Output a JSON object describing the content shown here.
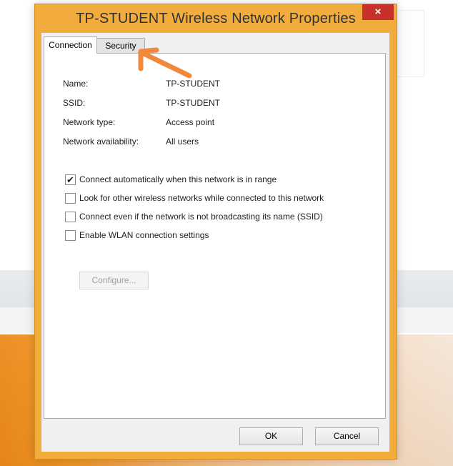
{
  "window": {
    "title": "TP-STUDENT Wireless Network Properties",
    "close_label": "×"
  },
  "tabs": [
    {
      "label": "Connection",
      "active": true
    },
    {
      "label": "Security",
      "active": false
    }
  ],
  "info": [
    {
      "label": "Name:",
      "value": "TP-STUDENT"
    },
    {
      "label": "SSID:",
      "value": "TP-STUDENT"
    },
    {
      "label": "Network type:",
      "value": "Access point"
    },
    {
      "label": "Network availability:",
      "value": "All users"
    }
  ],
  "options": [
    {
      "label": "Connect automatically when this network is in range",
      "checked": true
    },
    {
      "label": "Look for other wireless networks while connected to this network",
      "checked": false
    },
    {
      "label": "Connect even if the network is not broadcasting its name (SSID)",
      "checked": false
    },
    {
      "label": "Enable WLAN connection settings",
      "checked": false
    }
  ],
  "buttons": {
    "configure": "Configure...",
    "ok": "OK",
    "cancel": "Cancel"
  },
  "colors": {
    "window_border": "#f2ab3d",
    "close_button": "#c7302b",
    "annotation_arrow": "#f0893c"
  },
  "annotation": {
    "icon": "arrow-pointer-icon"
  }
}
